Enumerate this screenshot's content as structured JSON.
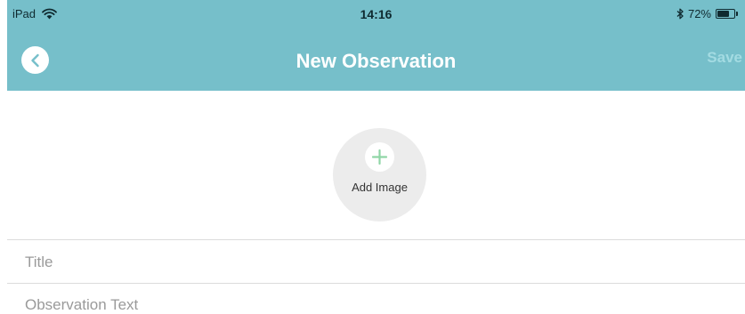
{
  "status_bar": {
    "device": "iPad",
    "time": "14:16",
    "battery_percent": "72%",
    "battery_level": 0.72,
    "icons": [
      "wifi-icon",
      "bluetooth-icon",
      "battery-icon"
    ]
  },
  "nav": {
    "title": "New Observation",
    "save_label": "Save",
    "back_icon": "chevron-left-icon"
  },
  "add_image": {
    "label": "Add Image",
    "icon": "plus-icon"
  },
  "form": {
    "title_placeholder": "Title",
    "title_value": "",
    "text_placeholder": "Observation Text",
    "text_value": ""
  },
  "colors": {
    "header": "#76bfca",
    "save_disabled": "#a3dbe2",
    "plus": "#8fd6a6",
    "image_circle": "#ececec"
  }
}
